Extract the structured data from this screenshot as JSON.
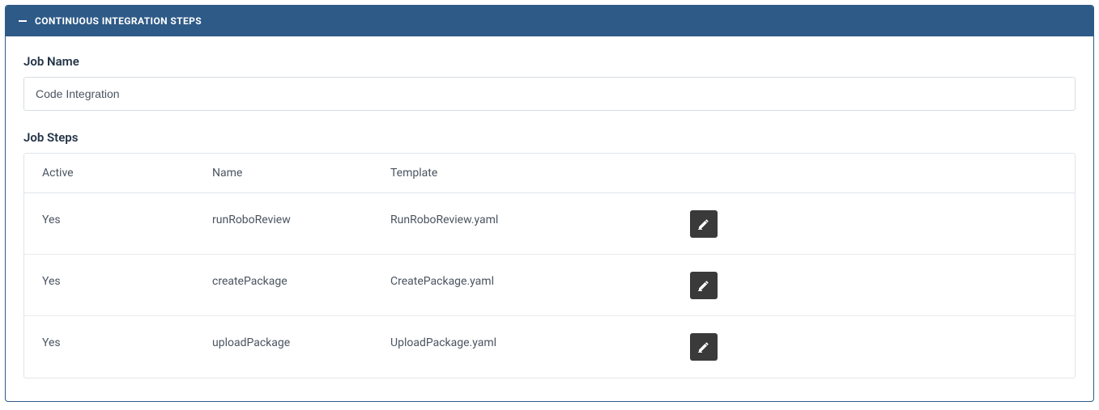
{
  "panel": {
    "title": "CONTINUOUS INTEGRATION STEPS"
  },
  "job": {
    "name_label": "Job Name",
    "name_value": "Code Integration",
    "steps_label": "Job Steps"
  },
  "table": {
    "headers": {
      "active": "Active",
      "name": "Name",
      "template": "Template"
    },
    "rows": [
      {
        "active": "Yes",
        "name": "runRoboReview",
        "template": "RunRoboReview.yaml"
      },
      {
        "active": "Yes",
        "name": "createPackage",
        "template": "CreatePackage.yaml"
      },
      {
        "active": "Yes",
        "name": "uploadPackage",
        "template": "UploadPackage.yaml"
      }
    ]
  }
}
